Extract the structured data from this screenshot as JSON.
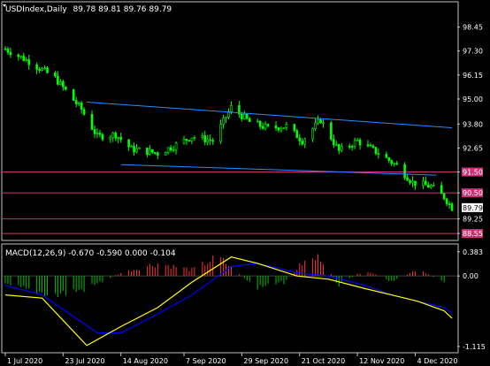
{
  "header": {
    "symbol": "USDIndex,Daily",
    "ohlc": "89.78 89.81 89.76 89.79"
  },
  "macd_label": "MACD(12,26,9) -0.670 -0.590 0.000 -0.104",
  "colors": {
    "background": "#000000",
    "grid_frame": "#c0c0c0",
    "bull_candle": "#00ff00",
    "bear_candle": "#00ff00",
    "trendline": "#1e90ff",
    "level_line": "#cc3377",
    "level_label_bg": "#cc3377",
    "current_price_bg": "#ffffff",
    "hist_pos": "#ff3030",
    "hist_neg": "#00c000",
    "macd_line": "#ffff00",
    "signal_line": "#0000ff"
  },
  "chart_data": {
    "type": "candlestick",
    "price_panel": {
      "y_ticks": [
        "98.45",
        "97.30",
        "96.15",
        "95.00",
        "93.80",
        "92.65",
        "91.50",
        "90.50",
        "89.25",
        "88.55"
      ],
      "ylim": [
        88.3,
        98.9
      ],
      "current_price": "89.79",
      "highlighted_levels": [
        "91.50",
        "90.50",
        "88.55"
      ],
      "horizontal_levels": [
        91.5,
        90.5,
        89.25,
        88.55
      ],
      "trendlines": [
        {
          "from": [
            "2020-08-01",
            94.85
          ],
          "to": [
            "2020-12-18",
            93.62
          ]
        },
        {
          "from": [
            "2020-08-14",
            91.85
          ],
          "to": [
            "2020-12-12",
            91.35
          ]
        }
      ],
      "close_path": [
        [
          "2020-07-01",
          97.4
        ],
        [
          "2020-07-10",
          96.8
        ],
        [
          "2020-07-20",
          96.0
        ],
        [
          "2020-07-30",
          94.5
        ],
        [
          "2020-08-05",
          93.2
        ],
        [
          "2020-08-12",
          93.3
        ],
        [
          "2020-08-18",
          92.6
        ],
        [
          "2020-08-28",
          92.4
        ],
        [
          "2020-09-04",
          92.8
        ],
        [
          "2020-09-10",
          93.2
        ],
        [
          "2020-09-18",
          93.0
        ],
        [
          "2020-09-25",
          94.6
        ],
        [
          "2020-10-02",
          93.9
        ],
        [
          "2020-10-09",
          93.6
        ],
        [
          "2020-10-16",
          93.7
        ],
        [
          "2020-10-22",
          93.0
        ],
        [
          "2020-10-29",
          94.0
        ],
        [
          "2020-11-05",
          92.5
        ],
        [
          "2020-11-12",
          93.0
        ],
        [
          "2020-11-20",
          92.4
        ],
        [
          "2020-11-27",
          91.8
        ],
        [
          "2020-12-03",
          91.0
        ],
        [
          "2020-12-10",
          90.8
        ],
        [
          "2020-12-15",
          90.3
        ],
        [
          "2020-12-18",
          89.79
        ]
      ]
    },
    "macd_panel": {
      "y_ticks": [
        "0.383",
        "0.00",
        "-1.115"
      ],
      "ylim": [
        -1.2,
        0.45
      ],
      "histogram": [
        [
          "2020-07-01",
          -0.15
        ],
        [
          "2020-07-20",
          -0.3
        ],
        [
          "2020-08-01",
          -0.2
        ],
        [
          "2020-08-14",
          0.05
        ],
        [
          "2020-08-28",
          0.2
        ],
        [
          "2020-09-10",
          0.1
        ],
        [
          "2020-09-20",
          0.3
        ],
        [
          "2020-10-05",
          -0.2
        ],
        [
          "2020-10-15",
          -0.1
        ],
        [
          "2020-10-22",
          0.2
        ],
        [
          "2020-10-29",
          0.3
        ],
        [
          "2020-11-05",
          -0.15
        ],
        [
          "2020-11-15",
          0.1
        ],
        [
          "2020-11-25",
          -0.1
        ],
        [
          "2020-12-05",
          0.1
        ],
        [
          "2020-12-15",
          -0.1
        ]
      ],
      "macd_line": [
        [
          "2020-07-01",
          -0.3
        ],
        [
          "2020-07-15",
          -0.35
        ],
        [
          "2020-08-01",
          -1.1
        ],
        [
          "2020-08-14",
          -0.8
        ],
        [
          "2020-08-28",
          -0.5
        ],
        [
          "2020-09-10",
          -0.1
        ],
        [
          "2020-09-25",
          0.3
        ],
        [
          "2020-10-05",
          0.2
        ],
        [
          "2020-10-20",
          0.0
        ],
        [
          "2020-11-01",
          -0.05
        ],
        [
          "2020-11-15",
          -0.2
        ],
        [
          "2020-11-25",
          -0.3
        ],
        [
          "2020-12-05",
          -0.4
        ],
        [
          "2020-12-15",
          -0.55
        ],
        [
          "2020-12-18",
          -0.67
        ]
      ],
      "signal_line": [
        [
          "2020-07-01",
          -0.15
        ],
        [
          "2020-07-15",
          -0.3
        ],
        [
          "2020-08-05",
          -0.9
        ],
        [
          "2020-08-14",
          -0.9
        ],
        [
          "2020-08-28",
          -0.6
        ],
        [
          "2020-09-10",
          -0.3
        ],
        [
          "2020-09-25",
          0.15
        ],
        [
          "2020-10-05",
          0.2
        ],
        [
          "2020-10-20",
          0.05
        ],
        [
          "2020-11-01",
          0.0
        ],
        [
          "2020-11-15",
          -0.15
        ],
        [
          "2020-11-25",
          -0.3
        ],
        [
          "2020-12-05",
          -0.4
        ],
        [
          "2020-12-15",
          -0.5
        ],
        [
          "2020-12-18",
          -0.59
        ]
      ]
    },
    "x_ticks": [
      "1 Jul 2020",
      "23 Jul 2020",
      "14 Aug 2020",
      "7 Sep 2020",
      "29 Sep 2020",
      "21 Oct 2020",
      "12 Nov 2020",
      "4 Dec 2020"
    ],
    "xlim": [
      "2020-06-30",
      "2020-12-20"
    ]
  }
}
